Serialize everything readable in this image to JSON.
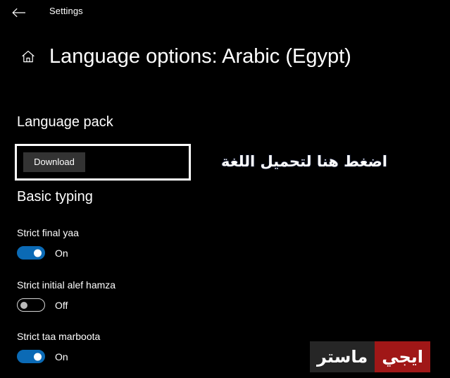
{
  "titlebar": {
    "back_icon": "back-arrow-icon",
    "app_name": "Settings"
  },
  "header": {
    "home_icon": "home-icon",
    "title": "Language options: Arabic (Egypt)"
  },
  "sections": {
    "language_pack": {
      "heading": "Language pack",
      "download_label": "Download"
    },
    "basic_typing": {
      "heading": "Basic typing"
    }
  },
  "annotation": {
    "text": "اضغط هنا لتحميل اللغة",
    "box_color": "#ffffff"
  },
  "settings": [
    {
      "label": "Strict final yaa",
      "state": "On",
      "on": true
    },
    {
      "label": "Strict initial alef hamza",
      "state": "Off",
      "on": false
    },
    {
      "label": "Strict taa marboota",
      "state": "On",
      "on": true
    }
  ],
  "watermark": {
    "part_red": "ايجي",
    "part_dark": "ماستر",
    "red_color": "#a01717",
    "dark_color": "#262626"
  },
  "colors": {
    "background": "#000000",
    "accent": "#0b6ab5",
    "button": "#333333",
    "text": "#ffffff"
  }
}
